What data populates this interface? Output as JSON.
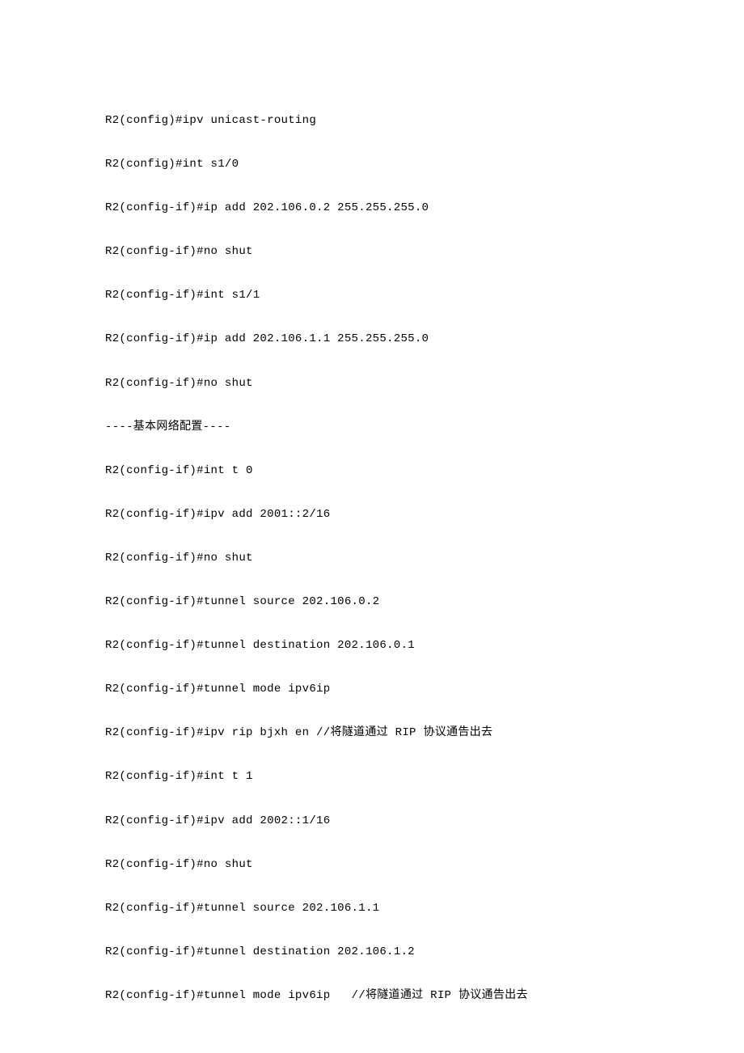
{
  "lines": [
    "R2(config)#ipv unicast-routing",
    "R2(config)#int s1/0",
    "R2(config-if)#ip add 202.106.0.2 255.255.255.0",
    "R2(config-if)#no shut",
    "R2(config-if)#int s1/1",
    "R2(config-if)#ip add 202.106.1.1 255.255.255.0",
    "R2(config-if)#no shut",
    "----基本网络配置----",
    "R2(config-if)#int t 0",
    "R2(config-if)#ipv add 2001::2/16",
    "R2(config-if)#no shut",
    "R2(config-if)#tunnel source 202.106.0.2",
    "R2(config-if)#tunnel destination 202.106.0.1",
    "R2(config-if)#tunnel mode ipv6ip",
    "R2(config-if)#ipv rip bjxh en //将隧道通过 RIP 协议通告出去",
    "R2(config-if)#int t 1",
    "R2(config-if)#ipv add 2002::1/16",
    "R2(config-if)#no shut",
    "R2(config-if)#tunnel source 202.106.1.1",
    "R2(config-if)#tunnel destination 202.106.1.2",
    "R2(config-if)#tunnel mode ipv6ip   //将隧道通过 RIP 协议通告出去"
  ]
}
